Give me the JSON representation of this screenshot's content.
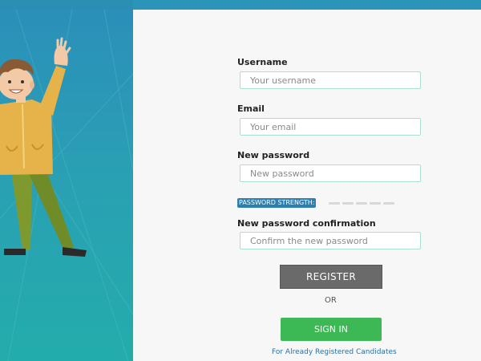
{
  "colors": {
    "top_bar": "#2b94b8",
    "panel_gradient_top": "#2b8fb9",
    "panel_gradient_bottom": "#23adaa",
    "register_button": "#6a6a6a",
    "signin_button": "#3cb954",
    "strength_badge": "#2e7fae",
    "link": "#2e6f9e"
  },
  "form": {
    "username": {
      "label": "Username",
      "placeholder": "Your username"
    },
    "email": {
      "label": "Email",
      "placeholder": "Your email"
    },
    "password": {
      "label": "New password",
      "placeholder": "New password"
    },
    "strength": {
      "label": "PASSWORD STRENGTH:"
    },
    "confirm": {
      "label": "New password confirmation",
      "placeholder": "Confirm the new password"
    },
    "register_label": "REGISTER",
    "or_text": "OR",
    "signin_label": "SIGN IN",
    "already_text": "For Already Registered Candidates"
  }
}
